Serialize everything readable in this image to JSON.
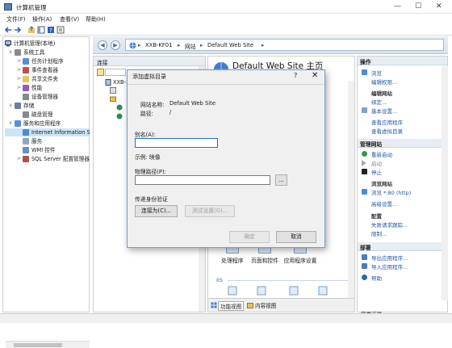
{
  "window": {
    "title": "计算机管理",
    "min": "—",
    "max": "☐",
    "close": "✕"
  },
  "menu": [
    "文件(F)",
    "操作(A)",
    "查看(V)",
    "帮助(H)"
  ],
  "tree": {
    "root": "计算机管理(本地)",
    "items": [
      {
        "label": "系统工具",
        "level": 1,
        "expander": "∨",
        "icon": "tools-icon"
      },
      {
        "label": "任务计划程序",
        "level": 2,
        "expander": ">",
        "icon": "task-scheduler-icon"
      },
      {
        "label": "事件查看器",
        "level": 2,
        "expander": ">",
        "icon": "event-viewer-icon"
      },
      {
        "label": "共享文件夹",
        "level": 2,
        "expander": ">",
        "icon": "shared-folder-icon"
      },
      {
        "label": "性能",
        "level": 2,
        "expander": ">",
        "icon": "performance-icon"
      },
      {
        "label": "设备管理器",
        "level": 2,
        "expander": "",
        "icon": "device-manager-icon"
      },
      {
        "label": "存储",
        "level": 1,
        "expander": "∨",
        "icon": "storage-icon"
      },
      {
        "label": "磁盘管理",
        "level": 2,
        "expander": "",
        "icon": "disk-icon"
      },
      {
        "label": "服务和应用程序",
        "level": 1,
        "expander": "∨",
        "icon": "services-apps-icon"
      },
      {
        "label": "Internet Information S",
        "level": 2,
        "expander": "",
        "icon": "iis-icon",
        "selected": true
      },
      {
        "label": "服务",
        "level": 2,
        "expander": "",
        "icon": "services-icon"
      },
      {
        "label": "WMI 控件",
        "level": 2,
        "expander": "",
        "icon": "wmi-icon"
      },
      {
        "label": "SQL Server 配置管理器",
        "level": 2,
        "expander": ">",
        "icon": "sql-icon"
      }
    ]
  },
  "address": {
    "segments": [
      "XXB-KF01",
      "网站",
      "Default Web Site"
    ],
    "arrow": "▸"
  },
  "connections": {
    "header": "连接",
    "node1": "XXB-…"
  },
  "center": {
    "title": "Default Web Site 主页",
    "icons": [
      {
        "label": "处理程序",
        "icon": "handler-icon"
      },
      {
        "label": "页面和控件",
        "icon": "pages-controls-icon"
      },
      {
        "label": "应用程序设置",
        "icon": "app-settings-icon"
      }
    ],
    "group": "IIS",
    "tabs": [
      "功能视图",
      "内容视图"
    ]
  },
  "actions": {
    "header": "操作",
    "browse": "浏览",
    "edit_perms": "编辑权限...",
    "edit_site_header": "编辑网站",
    "bindings": "绑定...",
    "basic_settings": "基本设置...",
    "view_apps": "查看应用程序",
    "view_vdirs": "查看虚拟目录",
    "manage_site_header": "管理网站",
    "restart": "重新启动",
    "start": "启动",
    "stop": "停止",
    "browse_site_header": "浏览网站",
    "browse_80": "浏览 *:80 (http)",
    "advanced": "高级设置...",
    "config_header": "配置",
    "failed_req": "失败请求跟踪...",
    "limits": "限制...",
    "deploy_header": "部署",
    "export_app": "导出应用程序...",
    "import_app": "导入应用程序...",
    "help": "帮助",
    "bottom_cut": "常用选项"
  },
  "dialog": {
    "title": "添加虚拟目录",
    "help": "?",
    "close": "✕",
    "site_name_label": "网站名称:",
    "site_name_value": "Default Web Site",
    "path_label": "路径:",
    "path_value": "/",
    "alias_label": "别名(A):",
    "alias_value": "",
    "example": "示例: 映像",
    "phys_label": "物理路径(P):",
    "phys_value": "",
    "browse_btn": "...",
    "passthrough": "传递身份验证",
    "connect_as": "连接为(C)...",
    "test_settings": "测试设置(G)...",
    "ok": "确定",
    "cancel": "取消"
  },
  "colors": {
    "accent": "#1f56a6",
    "selection": "#cce4f7",
    "header": "#e8edf3"
  }
}
